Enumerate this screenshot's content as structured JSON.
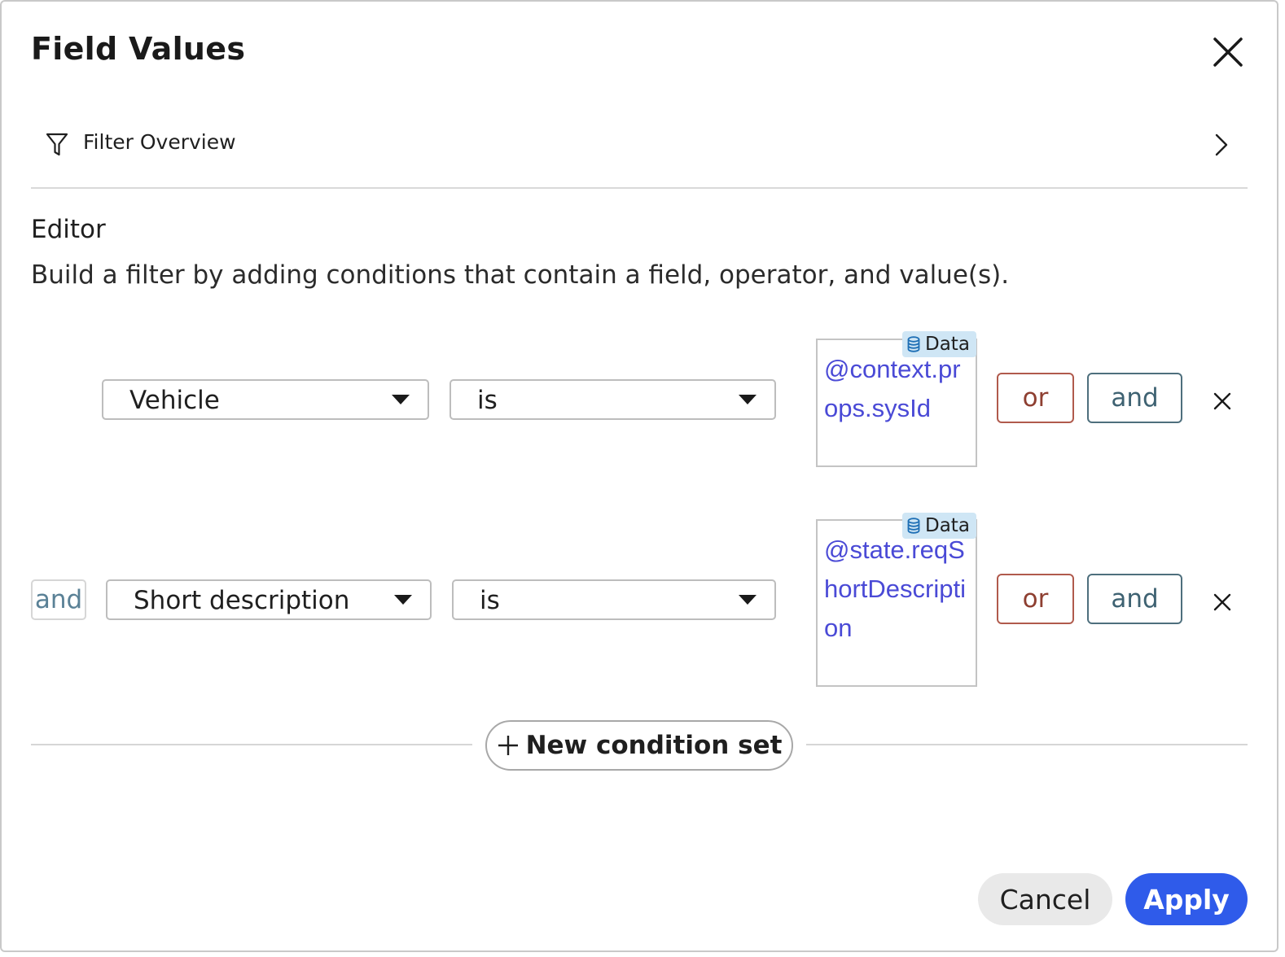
{
  "dialog": {
    "title": "Field Values",
    "close_icon": "close-icon"
  },
  "overview": {
    "icon": "filter-icon",
    "label": "Filter Overview",
    "chevron_icon": "chevron-right-icon"
  },
  "editor": {
    "title": "Editor",
    "description": "Build a filter by adding conditions that contain a field, operator, and value(s)."
  },
  "conditions": [
    {
      "field": "Vehicle",
      "operator": "is",
      "value": "@context.props.sysId",
      "value_badge": "Data",
      "or_label": "or",
      "and_label": "and"
    },
    {
      "connector": "and",
      "field": "Short description",
      "operator": "is",
      "value": "@state.reqShortDescription",
      "value_badge": "Data",
      "or_label": "or",
      "and_label": "and"
    }
  ],
  "new_condition_set_label": "New condition set",
  "footer": {
    "cancel_label": "Cancel",
    "apply_label": "Apply"
  },
  "colors": {
    "primary": "#2f5bea",
    "or_border": "#b05a4c",
    "and_border": "#4e6f7d",
    "value_text": "#4a4ad6",
    "data_badge": "#cfe6f5"
  }
}
